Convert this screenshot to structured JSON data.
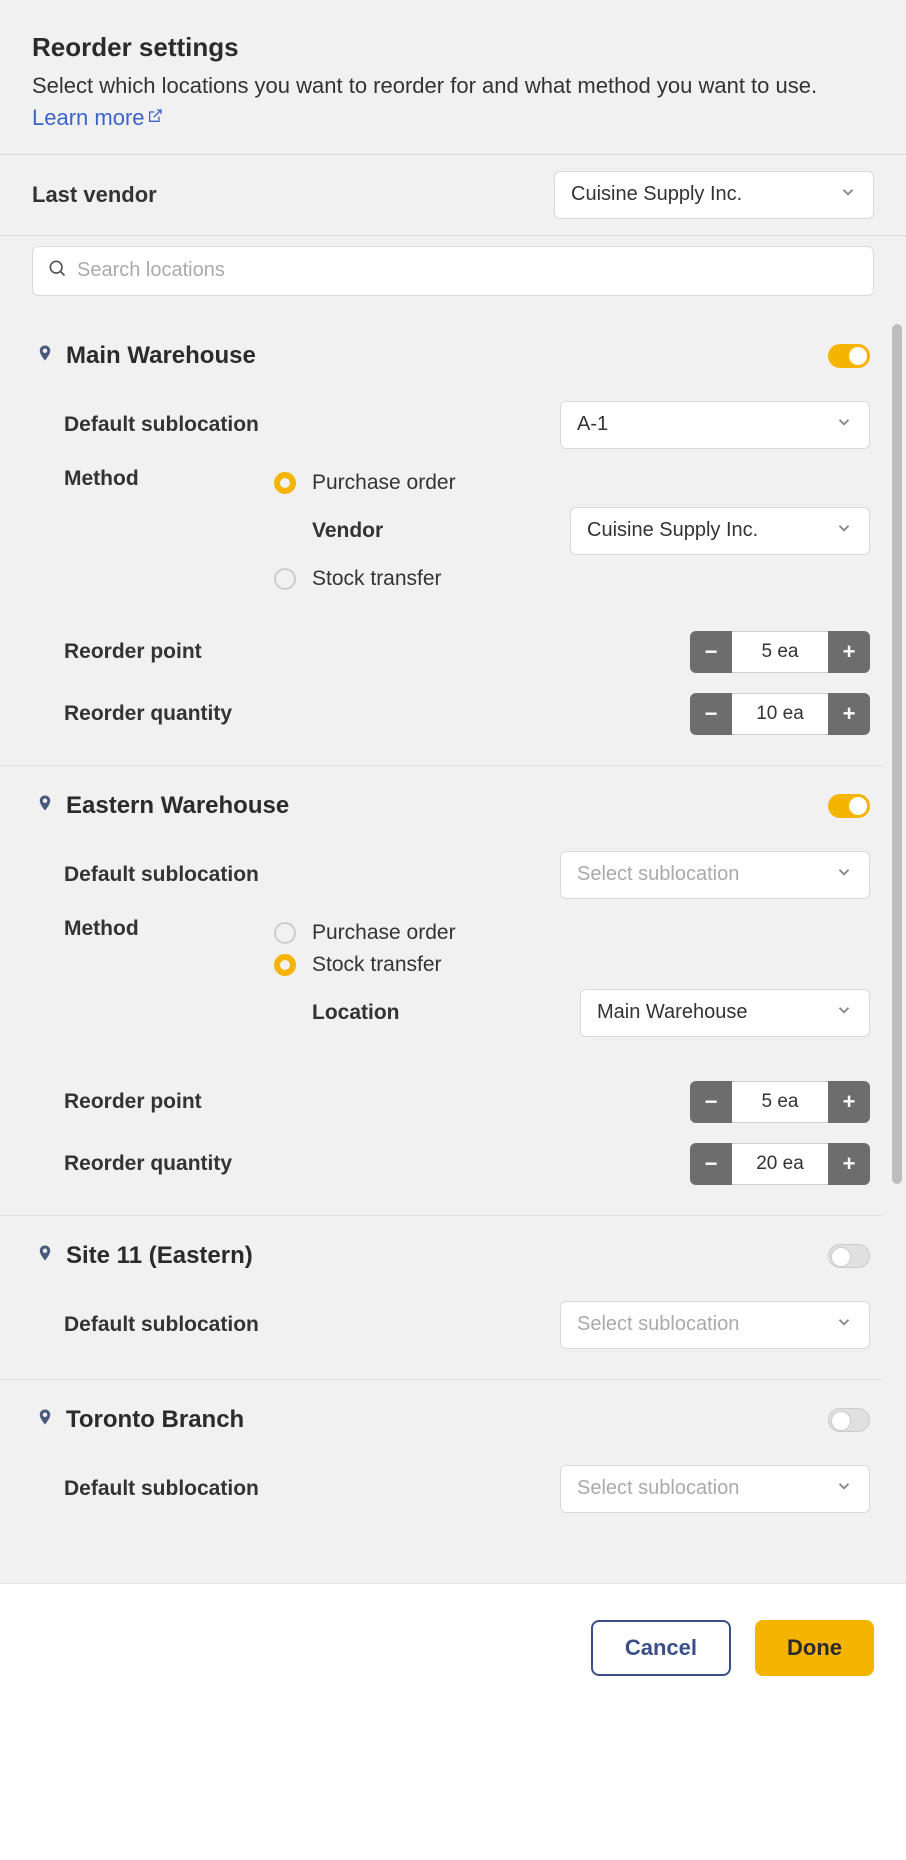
{
  "header": {
    "title": "Reorder settings",
    "subtitle_pre": "Select which locations you want to reorder for and what method you want to use. ",
    "learn_more": "Learn more"
  },
  "last_vendor": {
    "label": "Last vendor",
    "value": "Cuisine Supply Inc."
  },
  "search": {
    "placeholder": "Search locations"
  },
  "labels": {
    "default_sublocation": "Default sublocation",
    "method": "Method",
    "purchase_order": "Purchase order",
    "stock_transfer": "Stock transfer",
    "vendor": "Vendor",
    "location": "Location",
    "reorder_point": "Reorder point",
    "reorder_quantity": "Reorder quantity",
    "select_sublocation": "Select sublocation"
  },
  "locations": [
    {
      "name": "Main Warehouse",
      "enabled": true,
      "sublocation": "A-1",
      "method": "purchase_order",
      "vendor": "Cuisine Supply Inc.",
      "reorder_point": "5 ea",
      "reorder_quantity": "10 ea"
    },
    {
      "name": "Eastern Warehouse",
      "enabled": true,
      "sublocation": null,
      "method": "stock_transfer",
      "transfer_location": "Main Warehouse",
      "reorder_point": "5 ea",
      "reorder_quantity": "20 ea"
    },
    {
      "name": "Site 11 (Eastern)",
      "enabled": false,
      "sublocation": null
    },
    {
      "name": "Toronto Branch",
      "enabled": false,
      "sublocation": null
    }
  ],
  "footer": {
    "cancel": "Cancel",
    "done": "Done"
  }
}
